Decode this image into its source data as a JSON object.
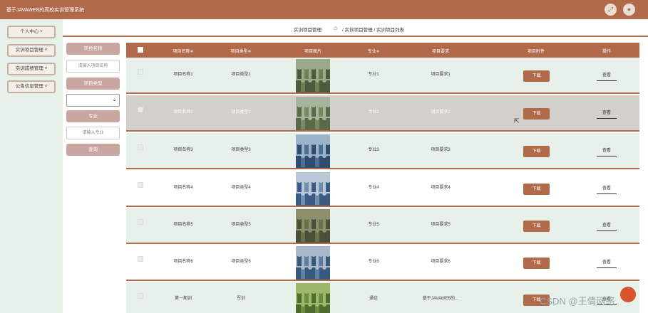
{
  "app": {
    "title": "基于JAVAWEB的高校实训管理系统"
  },
  "header": {
    "icons": [
      "expand-icon",
      "user-icon"
    ]
  },
  "sidebar": {
    "items": [
      {
        "label": "个人中心 ˅"
      },
      {
        "label": "实训项目管理 ˅"
      },
      {
        "label": "实训成绩管理 ˅"
      },
      {
        "label": "公告信息管理 ˅"
      }
    ]
  },
  "breadcrumb": {
    "title": "实训项目管理",
    "path": "/ 实训项目管理 / 实训项目列表"
  },
  "filters": {
    "name_label": "项目名称",
    "name_placeholder": "请输入项目名称",
    "type_label": "项目类型",
    "type_value": "",
    "major_label": "专业",
    "major_placeholder": "请输入专业",
    "search_label": "查询"
  },
  "table": {
    "headers": [
      "项目名称≑",
      "项目类型≑",
      "项目图片",
      "专业≑",
      "项目要求",
      "项目附件",
      "操作"
    ],
    "download_label": "下载",
    "view_label": "查看",
    "rows": [
      {
        "name": "项目名称1",
        "type": "项目类型1",
        "major": "专业1",
        "req": "项目要求1"
      },
      {
        "name": "项目名称2",
        "type": "项目类型2",
        "major": "专业2",
        "req": "项目要求2"
      },
      {
        "name": "项目名称3",
        "type": "项目类型3",
        "major": "专业3",
        "req": "项目要求3"
      },
      {
        "name": "项目名称4",
        "type": "项目类型4",
        "major": "专业4",
        "req": "项目要求4"
      },
      {
        "name": "项目名称5",
        "type": "项目类型5",
        "major": "专业5",
        "req": "项目要求5"
      },
      {
        "name": "项目名称6",
        "type": "项目类型6",
        "major": "专业6",
        "req": "项目要求6"
      },
      {
        "name": "第一期训",
        "type": "军训",
        "major": "通信",
        "req": "基于JAVAWEB的..."
      }
    ]
  },
  "watermark": "CSDN @王倩网络",
  "colors": {
    "accent": "#b06a4a",
    "sidebar_bg": "#e7f1ea",
    "label_bg": "#c9a6a0"
  }
}
